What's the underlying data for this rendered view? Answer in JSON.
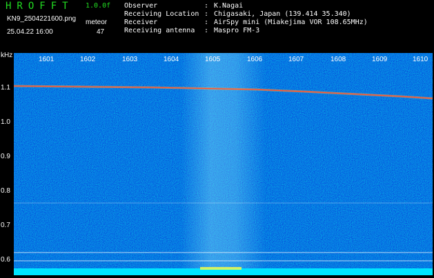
{
  "app": {
    "title": "HROFFT",
    "version": "1.0.0f"
  },
  "capture": {
    "filename": "KN9_2504221600.png",
    "mode": "meteor",
    "datetime": "25.04.22 16:00",
    "count": "47"
  },
  "info": [
    {
      "label": "Observer",
      "value": "K.Nagai"
    },
    {
      "label": "Receiving Location",
      "value": "Chigasaki, Japan (139.414 35.340)"
    },
    {
      "label": "Receiver",
      "value": "AirSpy mini (Miakejima VOR 108.65MHz)"
    },
    {
      "label": "Receiving antenna",
      "value": "Maspro FM-3"
    }
  ],
  "separator": ":",
  "axis": {
    "y_unit": "kHz",
    "y_ticks": [
      "1.1",
      "1.0",
      "0.9",
      "0.8",
      "0.7",
      "0.6"
    ],
    "x_ticks": [
      "1601",
      "1602",
      "1603",
      "1604",
      "1605",
      "1606",
      "1607",
      "1608",
      "1609",
      "1610"
    ]
  },
  "colors": {
    "background": "#000000",
    "title": "#22dd22",
    "spectrogram_base": "#1a2a8a",
    "baseline": "#00e5ff",
    "signal": "#ff5030"
  }
}
